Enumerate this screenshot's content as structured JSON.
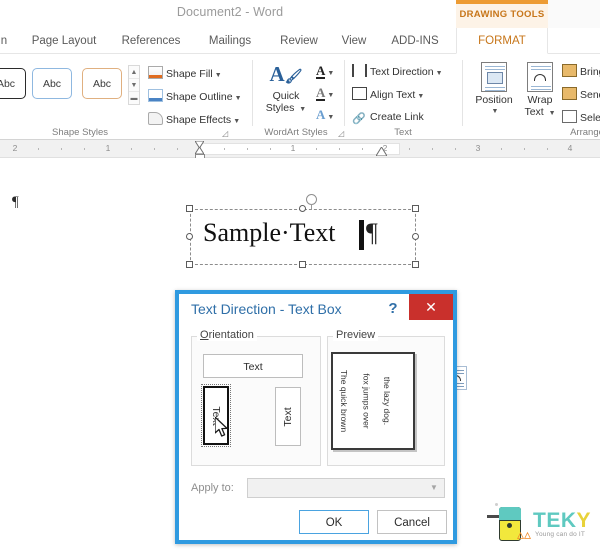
{
  "window": {
    "document_title": "Document2 - Word",
    "contextual_tab_group": "DRAWING TOOLS"
  },
  "tabs": [
    {
      "label": "n",
      "active": false
    },
    {
      "label": "Page Layout",
      "active": false
    },
    {
      "label": "References",
      "active": false
    },
    {
      "label": "Mailings",
      "active": false
    },
    {
      "label": "Review",
      "active": false
    },
    {
      "label": "View",
      "active": false
    },
    {
      "label": "ADD-INS",
      "active": false
    },
    {
      "label": "FORMAT",
      "active": true
    }
  ],
  "ribbon": {
    "groups": {
      "shape_styles": {
        "label": "Shape Styles",
        "gallery": [
          "Abc",
          "Abc",
          "Abc"
        ],
        "commands": [
          {
            "label": "Shape Fill",
            "icon": "paint-bucket-icon",
            "has_caret": true
          },
          {
            "label": "Shape Outline",
            "icon": "pen-outline-icon",
            "has_caret": true
          },
          {
            "label": "Shape Effects",
            "icon": "shape-effects-icon",
            "has_caret": true
          }
        ]
      },
      "wordart_styles": {
        "label": "WordArt Styles",
        "quick_styles": "Quick\nStyles",
        "quick_styles_line1": "Quick",
        "quick_styles_line2": "Styles",
        "rows": [
          {
            "icon": "text-fill-icon",
            "has_caret": true
          },
          {
            "icon": "text-outline-icon",
            "has_caret": true
          },
          {
            "icon": "text-effects-icon",
            "has_caret": true
          }
        ]
      },
      "text": {
        "label": "Text",
        "commands": [
          {
            "label": "Text Direction",
            "icon": "text-direction-icon",
            "has_caret": true
          },
          {
            "label": "Align Text",
            "icon": "align-text-icon",
            "has_caret": true
          },
          {
            "label": "Create Link",
            "icon": "create-link-icon",
            "has_caret": false
          }
        ]
      },
      "arrange": {
        "label": "Arrange",
        "position_line1": "Position",
        "wrap_line1": "Wrap",
        "wrap_line2": "Text",
        "commands": [
          {
            "label": "Bring",
            "icon": "bring-forward-icon"
          },
          {
            "label": "Send",
            "icon": "send-backward-icon"
          },
          {
            "label": "Select",
            "icon": "selection-pane-icon"
          }
        ]
      }
    }
  },
  "ruler": {
    "labels": [
      "2",
      "1",
      "1",
      "2",
      "3",
      "4"
    ]
  },
  "document": {
    "paragraph_mark": "¶",
    "textbox_text": "Sample·Text",
    "textbox_paragraph_mark": "¶",
    "layout_options_icon": "layout-options-icon"
  },
  "dialog": {
    "title": "Text Direction - Text Box",
    "help_label": "?",
    "close_label": "✕",
    "orientation": {
      "legend_prefix": "O",
      "legend_rest": "rientation",
      "options": [
        {
          "label": "Text",
          "direction": "horizontal",
          "selected": false
        },
        {
          "label": "Text",
          "direction": "rotate-90",
          "selected": true
        },
        {
          "label": "Text",
          "direction": "rotate-270",
          "selected": false
        }
      ]
    },
    "preview": {
      "legend": "Preview",
      "lines": [
        "The quick brown",
        "fox jumps over",
        "the lazy dog."
      ]
    },
    "apply_to": {
      "label": "Apply to:",
      "value": "",
      "enabled": false
    },
    "buttons": {
      "ok": "OK",
      "cancel": "Cancel"
    }
  },
  "watermark": {
    "brand": "TEK",
    "brand_accent": "Y",
    "tagline": "Young can do IT"
  },
  "colors": {
    "accent_orange": "#ed9b33",
    "contextual_text": "#c7761a",
    "dialog_border": "#2f9ae0",
    "dialog_title_text": "#2f6fa8",
    "close_red": "#c9302c",
    "brand_teal": "#5fc9c0",
    "brand_yellow": "#e8d23a"
  }
}
